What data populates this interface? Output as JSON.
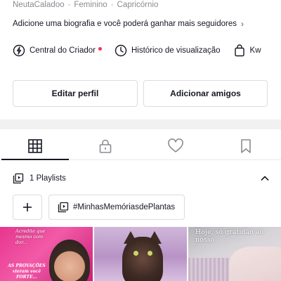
{
  "profile": {
    "meta": [
      "NeutaCaladoo",
      "Feminino",
      "Capricórnio"
    ],
    "meta_separator": "·",
    "bio_prompt": "Adicione uma biografia e você poderá ganhar mais seguidores",
    "bio_chevron": "›"
  },
  "creator_row": {
    "items": [
      {
        "icon": "lightning-circle-icon",
        "label": "Central do Criador",
        "has_notification": true
      },
      {
        "icon": "clock-history-icon",
        "label": "Histórico de visualização"
      },
      {
        "icon": "shopping-bag-icon",
        "label": "Kw"
      }
    ]
  },
  "actions": {
    "edit_profile": "Editar perfil",
    "add_friends": "Adicionar amigos"
  },
  "tabs": [
    {
      "icon": "grid-icon",
      "active": true
    },
    {
      "icon": "lock-icon",
      "active": false
    },
    {
      "icon": "heart-icon",
      "active": false
    },
    {
      "icon": "bookmark-icon",
      "active": false
    }
  ],
  "playlists": {
    "header_label": "1 Playlists",
    "expanded": true,
    "items": [
      {
        "name": "#MinhasMemóriasdePlantas"
      }
    ]
  },
  "videos": [
    {
      "overlay_top": "Acredite que mesmo com dor...",
      "overlay_bottom": "AS PROVAÇÕES vieram você FORTE..."
    },
    {
      "overlay_top": ""
    },
    {
      "overlay_top": "Hoje, só gratidão ao nosso"
    }
  ],
  "colors": {
    "accent_red": "#fe2c55",
    "text_primary": "#161823",
    "text_secondary": "#8a8b91",
    "border": "#dcdcdf"
  }
}
